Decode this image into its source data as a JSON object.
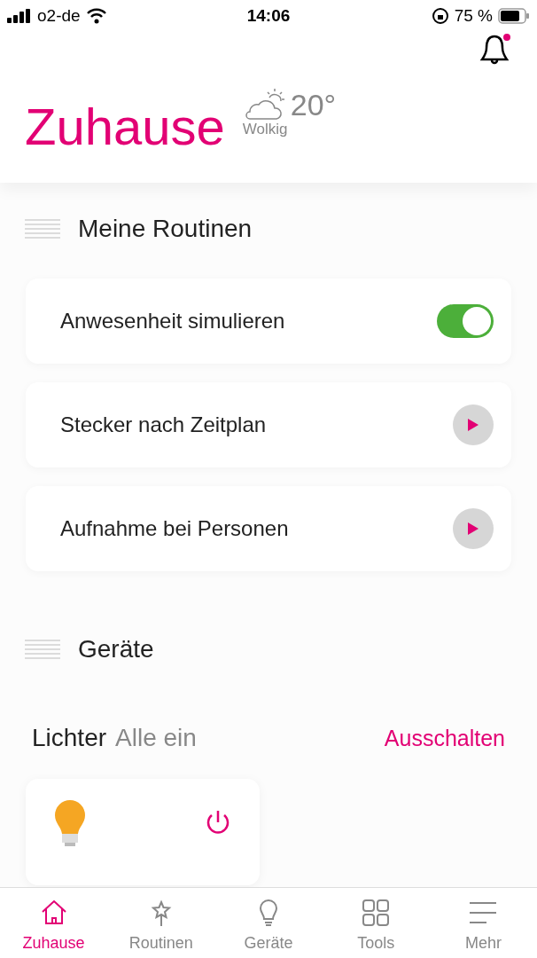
{
  "status_bar": {
    "carrier": "o2-de",
    "time": "14:06",
    "battery": "75 %"
  },
  "notifications": {
    "unread": true
  },
  "header": {
    "title": "Zuhause",
    "weather": {
      "temperature": "20°",
      "condition": "Wolkig"
    }
  },
  "routines_section": {
    "title": "Meine Routinen"
  },
  "routines": [
    {
      "label": "Anwesenheit simulieren",
      "kind": "toggle",
      "on": true
    },
    {
      "label": "Stecker nach Zeitplan",
      "kind": "play"
    },
    {
      "label": "Aufnahme bei Personen",
      "kind": "play"
    }
  ],
  "devices_section": {
    "title": "Geräte"
  },
  "lights": {
    "title": "Lichter",
    "status": "Alle ein",
    "action": "Ausschalten",
    "devices": [
      {
        "on": true
      }
    ]
  },
  "tab_bar": [
    {
      "label": "Zuhause",
      "kind": "home",
      "selected": true
    },
    {
      "label": "Routinen",
      "kind": "wand",
      "selected": false
    },
    {
      "label": "Geräte",
      "kind": "bulb",
      "selected": false
    },
    {
      "label": "Tools",
      "kind": "grid",
      "selected": false
    },
    {
      "label": "Mehr",
      "kind": "menu",
      "selected": false
    }
  ]
}
